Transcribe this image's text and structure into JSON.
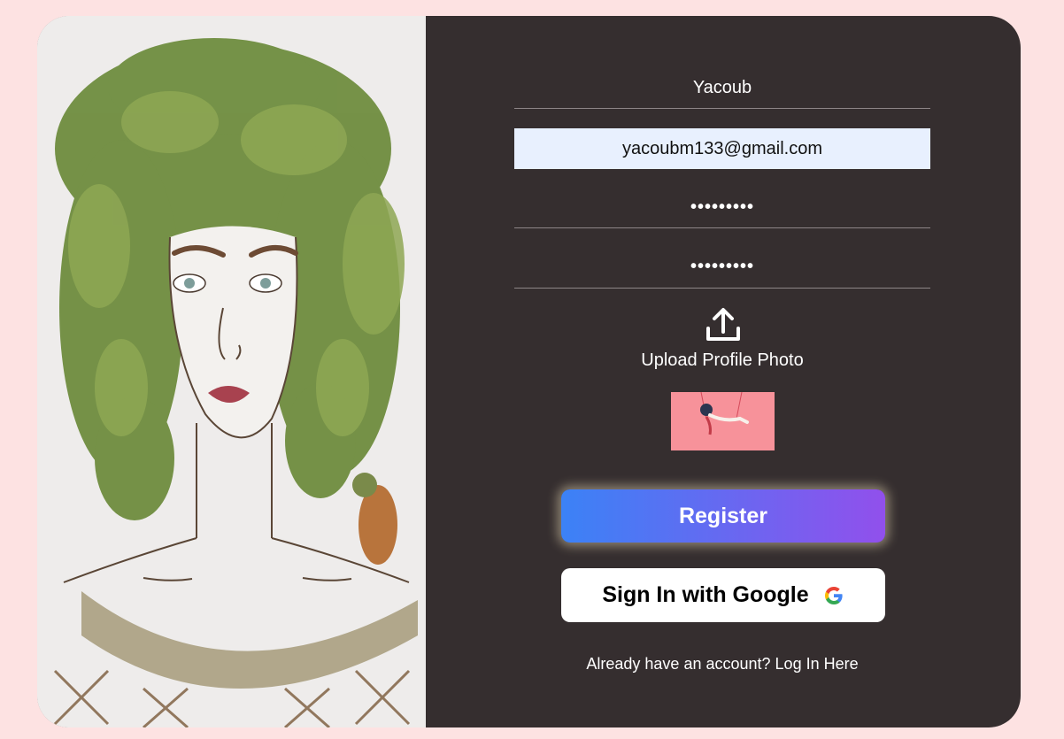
{
  "register": {
    "name_value": "Yacoub",
    "email_value": "yacoubm133@gmail.com",
    "password_value": "•••••••••",
    "confirm_password_value": "•••••••••",
    "upload_label": "Upload Profile Photo",
    "register_label": "Register",
    "google_label": "Sign In with Google",
    "login_prompt": "Already have an account?",
    "login_link": "Log In Here"
  },
  "icons": {
    "upload": "upload-icon",
    "google": "google-icon"
  },
  "colors": {
    "page_background": "#fde2e2",
    "panel_background": "#352e2f",
    "register_gradient_start": "#3b82f6",
    "register_gradient_end": "#9150ec",
    "email_field_background": "#e8f0fe"
  }
}
